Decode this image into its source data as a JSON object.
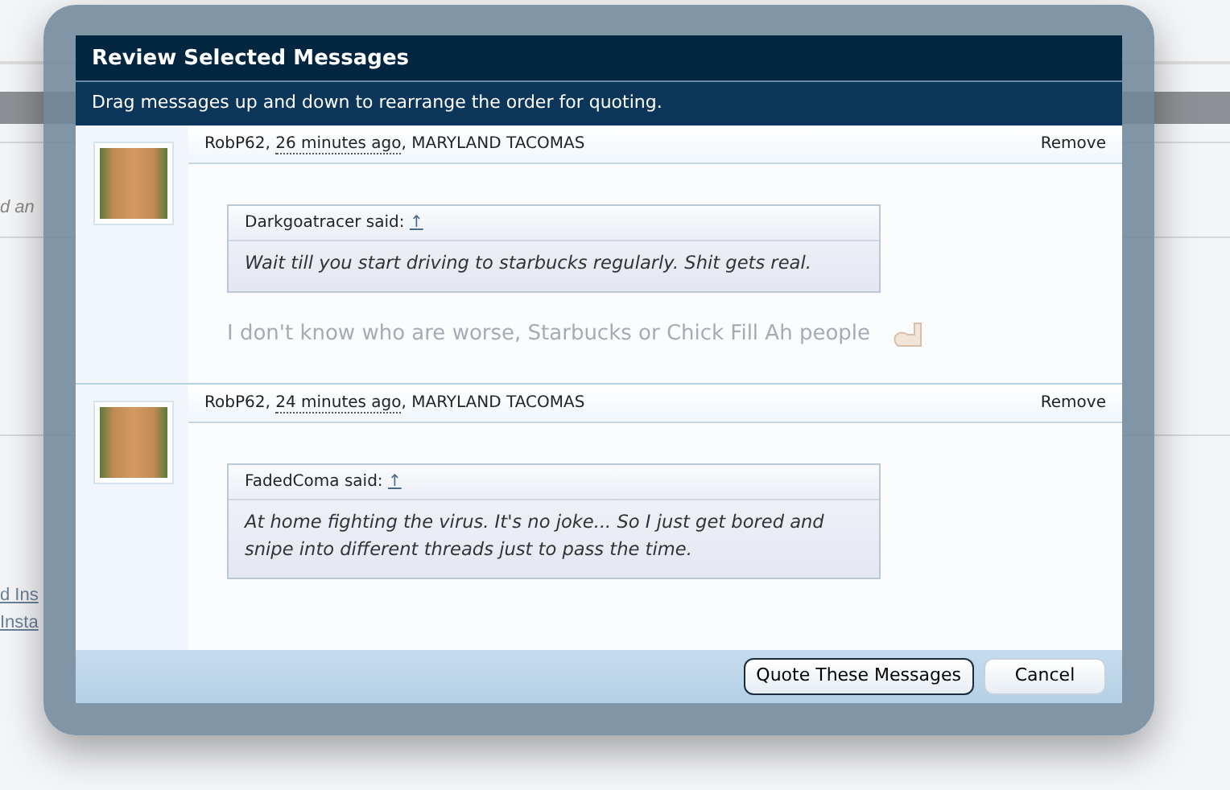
{
  "background": {
    "fragments": [
      {
        "text": "d an",
        "kind": "note"
      },
      {
        "text": "d Ins",
        "kind": "link"
      },
      {
        "text": "Insta",
        "kind": "link"
      }
    ]
  },
  "dialog": {
    "title": "Review Selected Messages",
    "subtitle": "Drag messages up and down to rearrange the order for quoting.",
    "messages": [
      {
        "author": "RobP62",
        "separators": [
          ",",
          ","
        ],
        "time": "26 minutes ago",
        "location": "MARYLAND TACOMAS",
        "remove": "Remove",
        "quote": {
          "source": "Darkgoatracer said:",
          "arrow": "↑",
          "text": "Wait till you start driving to starbucks regularly. Shit gets real."
        },
        "body": "I don't know who are worse, Starbucks or Chick Fill Ah people"
      },
      {
        "author": "RobP62",
        "separators": [
          ",",
          ","
        ],
        "time": "24 minutes ago",
        "location": "MARYLAND TACOMAS",
        "remove": "Remove",
        "quote": {
          "source": "FadedComa said:",
          "arrow": "↑",
          "text": "At home fighting the virus. It's no joke... So I just get bored and snipe into different threads just to pass the time."
        }
      }
    ],
    "buttons": [
      {
        "label": "Quote These Messages",
        "selected": true
      },
      {
        "label": "Cancel",
        "selected": false
      }
    ]
  }
}
